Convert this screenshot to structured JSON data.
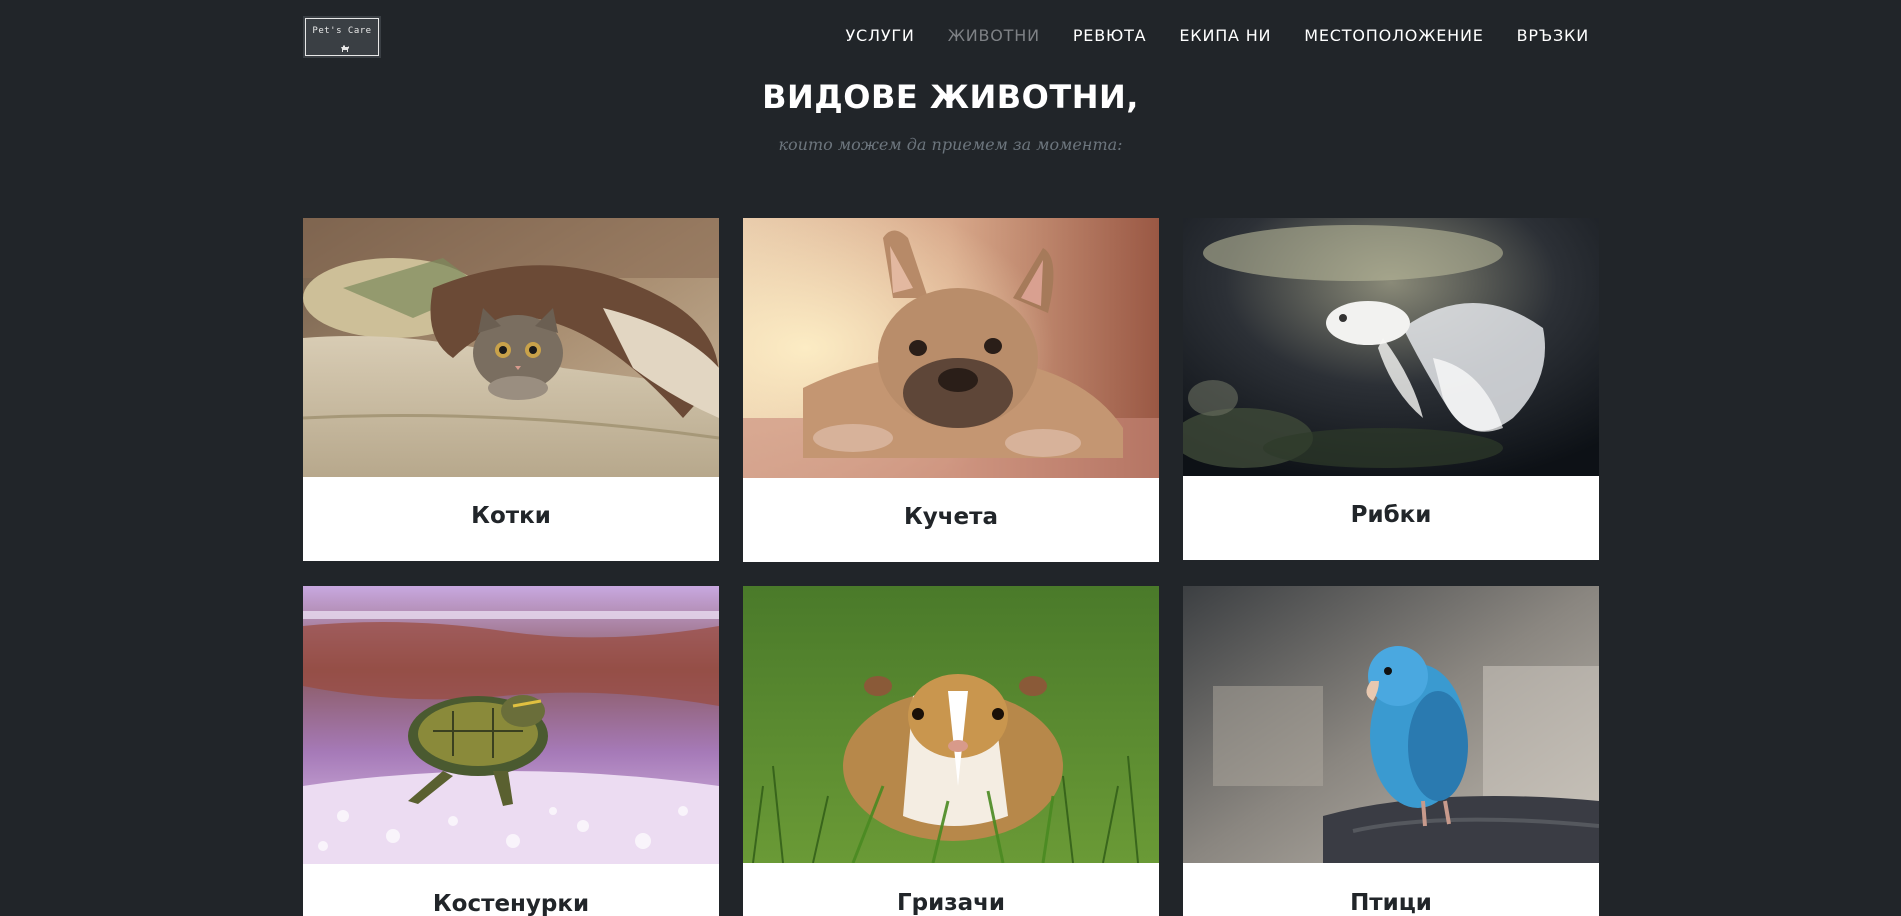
{
  "navbar": {
    "logo_text": "Pet's Care",
    "links": [
      {
        "label": "УСЛУГИ",
        "active": false
      },
      {
        "label": "ЖИВОТНИ",
        "active": true
      },
      {
        "label": "РЕВЮТА",
        "active": false
      },
      {
        "label": "ЕКИПА НИ",
        "active": false
      },
      {
        "label": "МЕСТОПОЛОЖЕНИЕ",
        "active": false
      },
      {
        "label": "ВРЪЗКИ",
        "active": false
      }
    ]
  },
  "section": {
    "title": "ВИДОВЕ ЖИВОТНИ,",
    "subtitle": "които можем да приемем за момента:"
  },
  "animals": [
    {
      "label": "Котки",
      "image": "cat-under-blanket"
    },
    {
      "label": "Кучета",
      "image": "french-bulldog"
    },
    {
      "label": "Рибки",
      "image": "white-betta-fish"
    },
    {
      "label": "Костенурки",
      "image": "turtle-in-aquarium"
    },
    {
      "label": "Гризачи",
      "image": "guinea-pig-in-grass"
    },
    {
      "label": "Птици",
      "image": "blue-parrot"
    }
  ],
  "colors": {
    "background": "#212529",
    "nav_active": "#7e8185",
    "subtitle": "#6c757d",
    "card_bg": "#ffffff",
    "card_text": "#212529"
  }
}
